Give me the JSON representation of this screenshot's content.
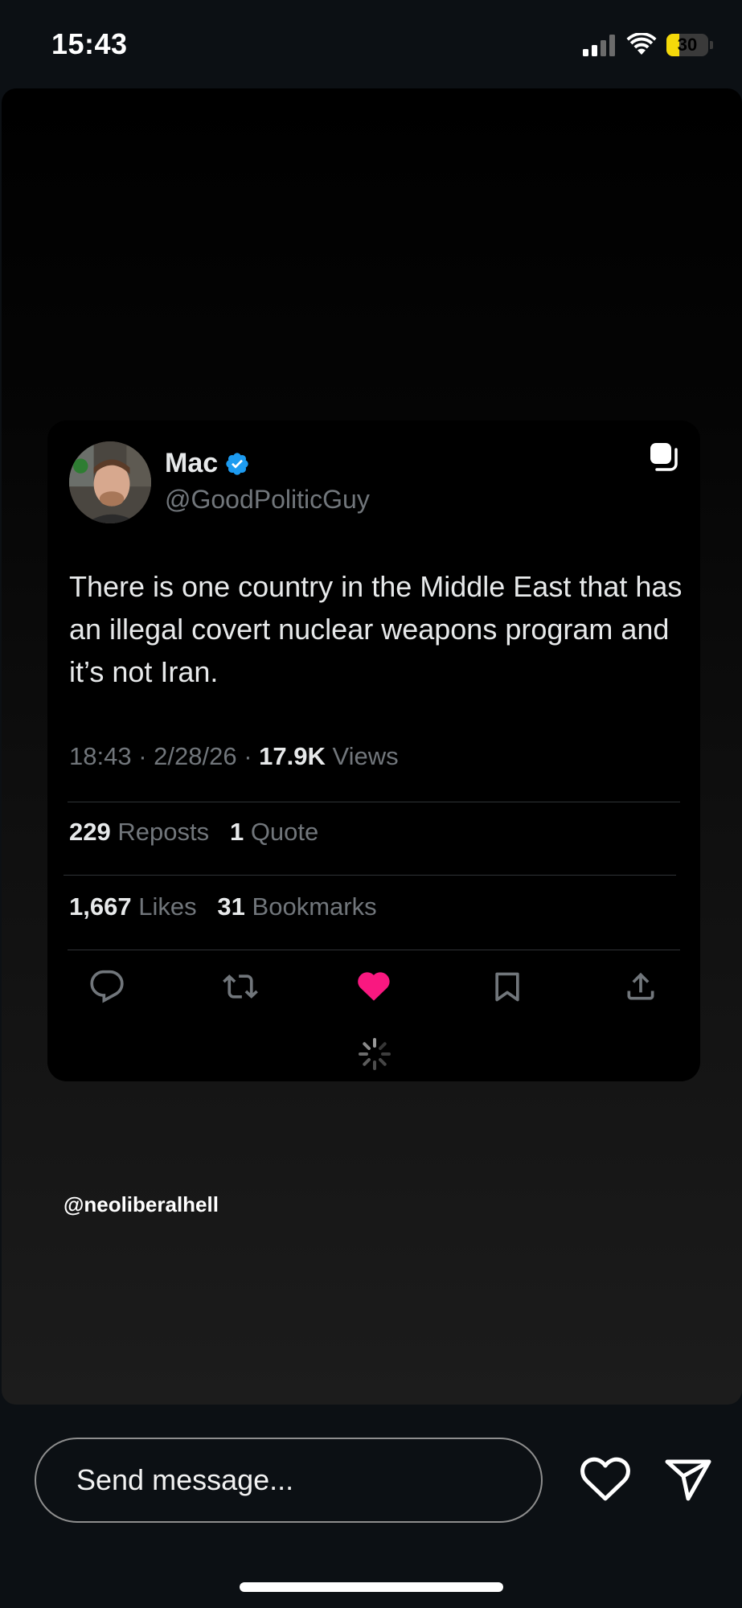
{
  "status_bar": {
    "time": "15:43",
    "battery_level": "30",
    "battery_fraction": 0.3,
    "battery_color": "#f5d90a",
    "icons": [
      "signal-icon",
      "wifi-icon",
      "battery-icon"
    ]
  },
  "tweet": {
    "display_name": "Mac",
    "handle": "@GoodPoliticGuy",
    "verified": true,
    "verified_color": "#1d9bf0",
    "text": "There is one country in the Middle East that has an illegal covert nuclear weapons program and it’s not Iran.",
    "time": "18:43",
    "date": "2/28/26",
    "separator": "·",
    "views_count": "17.9K",
    "views_label": "Views",
    "reposts_count": "229",
    "reposts_label": "Reposts",
    "quotes_count": "1",
    "quotes_label": "Quote",
    "likes_count": "1,667",
    "likes_label": "Likes",
    "bookmarks_count": "31",
    "bookmarks_label": "Bookmarks",
    "liked": true,
    "like_color": "#f91880",
    "actions": [
      "reply-icon",
      "retweet-icon",
      "like-icon",
      "bookmark-icon",
      "share-icon"
    ]
  },
  "story": {
    "username": "@neoliberalhell"
  },
  "bottom_bar": {
    "message_placeholder": "Send message...",
    "icons": [
      "heart-outline-icon",
      "send-icon"
    ]
  }
}
